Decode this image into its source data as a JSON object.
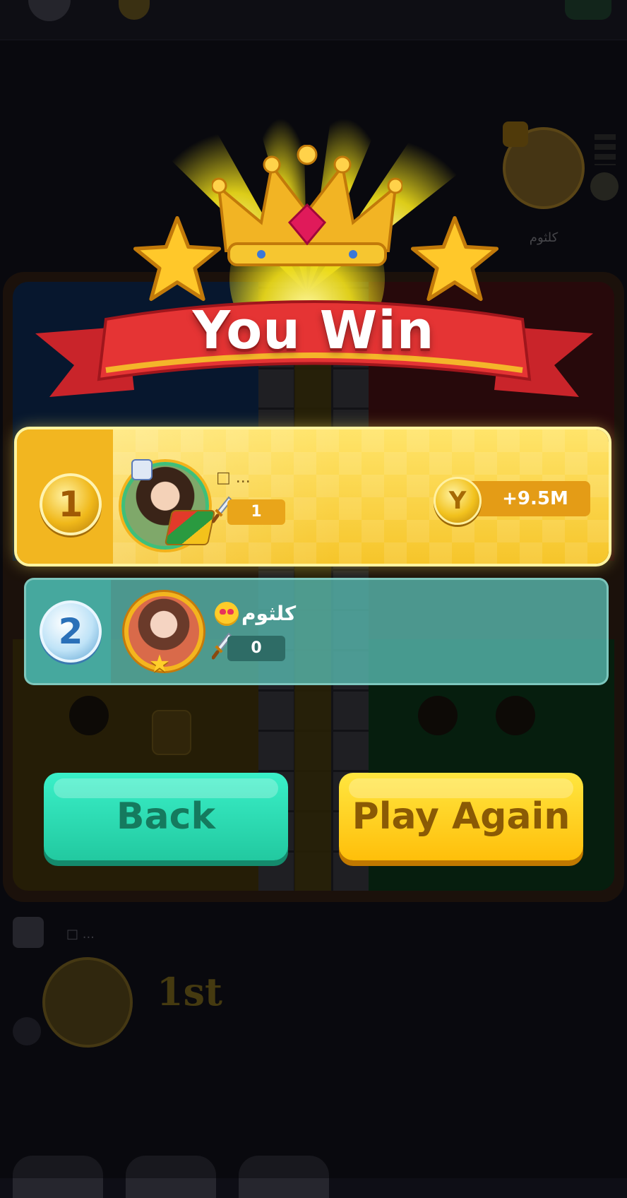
{
  "title": "You Win",
  "results": [
    {
      "rank": "1",
      "name": "□ ...",
      "score": "1",
      "reward": "+9.5M",
      "reward_coin_symbol": "Y"
    },
    {
      "rank": "2",
      "name": "کلثوم",
      "score": "0"
    }
  ],
  "buttons": {
    "back": "Back",
    "play_again": "Play Again"
  },
  "background": {
    "opponent_name": "کلثوم",
    "self_placement": "1st",
    "self_name": "□ ..."
  },
  "colors": {
    "gold": "#f6c52a",
    "teal": "#5abeb4",
    "back_button": "#2ad8b0",
    "play_again_button": "#ffcf1a",
    "banner_red": "#e03636"
  }
}
